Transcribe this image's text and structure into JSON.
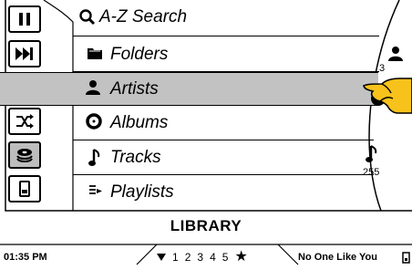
{
  "controls": [
    {
      "name": "pause-button",
      "icon": "pause-icon"
    },
    {
      "name": "next-track-button",
      "icon": "skip-forward-icon"
    },
    {
      "name": "previous-track-button",
      "icon": "skip-back-icon"
    },
    {
      "name": "shuffle-button",
      "icon": "shuffle-icon"
    },
    {
      "name": "library-button",
      "icon": "disc-stack-icon",
      "selected": true
    },
    {
      "name": "device-button",
      "icon": "ipod-icon"
    }
  ],
  "menu": {
    "items": [
      {
        "label": "A-Z Search",
        "icon": "search-icon"
      },
      {
        "label": "Folders",
        "icon": "folder-icon"
      },
      {
        "label": "Artists",
        "icon": "person-icon",
        "selected": true
      },
      {
        "label": "Albums",
        "icon": "disc-icon"
      },
      {
        "label": "Tracks",
        "icon": "music-note-icon"
      },
      {
        "label": "Playlists",
        "icon": "playlist-icon"
      }
    ]
  },
  "side_counts": {
    "artists_count": "3",
    "tracks_count": "255"
  },
  "screen_title": "LIBRARY",
  "status": {
    "time": "01:35 PM",
    "rating": {
      "marks": [
        "1",
        "2",
        "3",
        "4",
        "5"
      ],
      "star": "★"
    },
    "now_playing": "No One Like You"
  },
  "colors": {
    "selection": "#c2c2c2",
    "pointer_hand": "#f7c21b"
  }
}
